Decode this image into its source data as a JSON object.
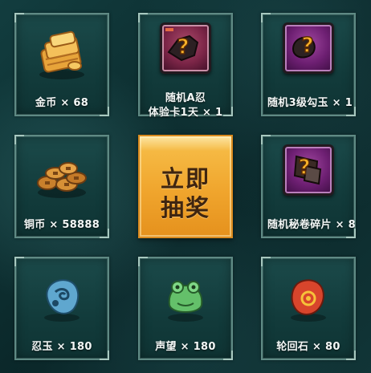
{
  "grid": {
    "items": [
      {
        "name": "金币 × 68",
        "icon": "gold-coins-icon"
      },
      {
        "name": "随机A忍",
        "name_line2": "体验卡1天 × 1",
        "icon": "mystery-box-icon"
      },
      {
        "name": "随机3级勾玉 × 1",
        "icon": "mystery-magatama-icon"
      },
      {
        "name": "铜币 × 58888",
        "icon": "copper-coins-icon"
      },
      {
        "name": "随机秘卷碎片 × 8",
        "icon": "mystery-scroll-fragment-icon"
      },
      {
        "name": "忍玉 × 180",
        "icon": "ninja-jade-icon"
      },
      {
        "name": "声望 × 180",
        "icon": "reputation-frog-icon"
      },
      {
        "name": "轮回石 × 80",
        "icon": "samsara-stone-icon"
      }
    ]
  },
  "draw_button": {
    "line1": "立即",
    "line2": "抽奖"
  },
  "colors": {
    "tile_border": "#5f8a84",
    "tile_bg": "#1b4a4a",
    "button_accent": "#f0a52d",
    "button_text": "#3f2510",
    "label_text": "#f3f7f6"
  }
}
